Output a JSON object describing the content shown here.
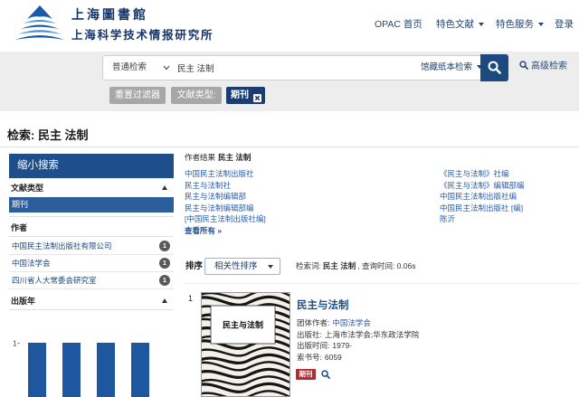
{
  "header": {
    "logo_line1": "上海圖書館",
    "logo_line2": "上海科学技术情报研究所",
    "nav": [
      {
        "label": "OPAC 首页"
      },
      {
        "label": "特色文献"
      },
      {
        "label": "特色服务"
      },
      {
        "label": "登录"
      }
    ]
  },
  "search": {
    "mode": "普通检索",
    "query": "民主 法制",
    "scope": "馆藏纸本检索",
    "advanced_label": "高级检索"
  },
  "filters": {
    "reset_label": "重置过滤器",
    "type_label": "文献类型:",
    "active_chip": "期刊"
  },
  "page_title": "检索: 民主 法制",
  "sidebar": {
    "title": "缩小搜索",
    "doc_type": {
      "title": "文献类型",
      "selected": "期刊"
    },
    "author": {
      "title": "作者",
      "items": [
        {
          "label": "中国民主法制出版社有限公司",
          "count": 1
        },
        {
          "label": "中国法学会",
          "count": 1
        },
        {
          "label": "四川省人大常委会研究室",
          "count": 1
        }
      ]
    },
    "year": {
      "title": "出版年"
    }
  },
  "chart_data": {
    "type": "bar",
    "values": [
      1,
      1,
      1,
      1
    ],
    "y_ticks": [
      1
    ]
  },
  "author_results": {
    "heading": "作者结果",
    "query": "民主 法制",
    "left": [
      "中国民主法制出版社",
      "民主与法制社",
      "民主与法制编辑部",
      "民主与法制编辑部编",
      "[中国民主法制出版社编]"
    ],
    "right": [
      "《民主与法制》社编",
      "《民主与法制》编辑部编",
      "中国民主法制出版社编",
      "中国民主法制出版社 [编]",
      "陈沂"
    ],
    "see_all": "查看所有 »"
  },
  "sort": {
    "label": "排序",
    "selected": "相关性排序",
    "terms_label": "检索词:",
    "terms": "民主 法制",
    "time_text": ", 查询时间: 0.06s"
  },
  "results": [
    {
      "number": "1",
      "title": "民主与法制",
      "cover_label": "民主与法制",
      "fields": [
        {
          "label": "团体作者:",
          "value": "中国法学会"
        },
        {
          "label": "出版社:",
          "value": "上海市法学会;华东政法学院"
        },
        {
          "label": "出版时间:",
          "value": "1979-"
        },
        {
          "label": "索书号:",
          "value": "6059"
        }
      ],
      "format_badge": "期刊"
    }
  ],
  "colors": {
    "primary": "#1f4f8a",
    "link": "#2a5ca8",
    "chart_bar": "#1f56a0",
    "selected_facet": "#2d5e9c",
    "chip": "#1b3c71",
    "filter_grey": "#a7a7a7",
    "badge_red": "#b02a2e",
    "band": "#ededed"
  },
  "icons": {
    "logo": "logo-wave-icon",
    "search": "search-icon",
    "dropdown": "chevron-down-icon",
    "menu_caret": "caret-down-icon",
    "collapse": "caret-up-icon",
    "remove_filter": "close-icon",
    "preview": "search-icon"
  }
}
